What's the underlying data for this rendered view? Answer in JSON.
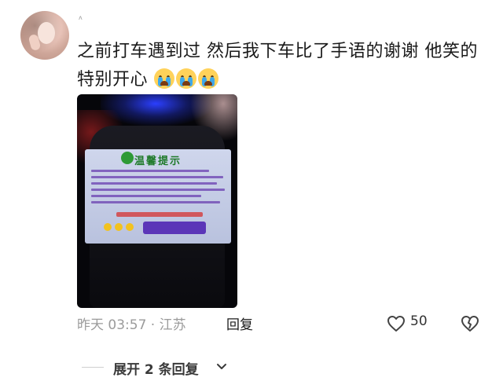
{
  "comment": {
    "tiny_mark": "ʌ",
    "text": "之前打车遇到过 然后我下车比了手语的谢谢 他笑的特别开心",
    "emojis": [
      "crying-face",
      "crying-face",
      "crying-face"
    ],
    "image": {
      "description_icon": "photo-of-car-seat-notice",
      "notice_title": "温馨提示"
    },
    "meta": "昨天 03:57 · 江苏",
    "reply_label": "回复",
    "like_count": "50"
  },
  "expand": {
    "label": "展开 2 条回复"
  }
}
